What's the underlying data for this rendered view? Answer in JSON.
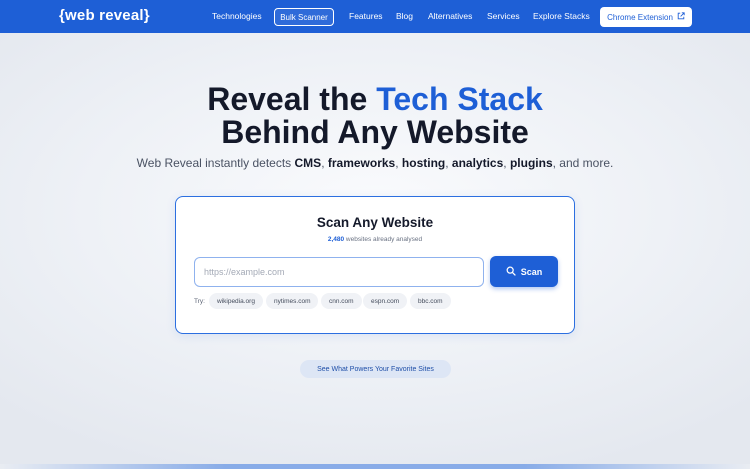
{
  "brand": {
    "logo": "{web reveal}"
  },
  "nav": {
    "items": [
      "Technologies",
      "Bulk Scanner",
      "Features",
      "Blog",
      "Alternatives",
      "Services",
      "Explore Stacks"
    ],
    "cta": "Chrome Extension"
  },
  "hero": {
    "title_part1": "Reveal the ",
    "title_accent": "Tech Stack",
    "title_line2": "Behind Any Website",
    "subtitle": {
      "intro": "Web Reveal instantly detects ",
      "cms": "CMS",
      "sep1": ", ",
      "frameworks": "frameworks",
      "sep2": ", ",
      "hosting": "hosting",
      "sep3": ", ",
      "analytics": "analytics",
      "sep4": ", ",
      "plugins": "plugins",
      "outro": ", and more."
    }
  },
  "scan": {
    "title": "Scan Any Website",
    "count": "2,480",
    "count_suffix": " websites already analysed",
    "placeholder": "https://example.com",
    "button": "Scan",
    "try_label": "Try:",
    "examples": [
      "wikipedia.org",
      "nytimes.com",
      "cnn.com",
      "espn.com",
      "bbc.com"
    ]
  },
  "secondary_cta": "See What Powers Your Favorite Sites",
  "colors": {
    "brand": "#1e5fd6",
    "text": "#14192a"
  }
}
